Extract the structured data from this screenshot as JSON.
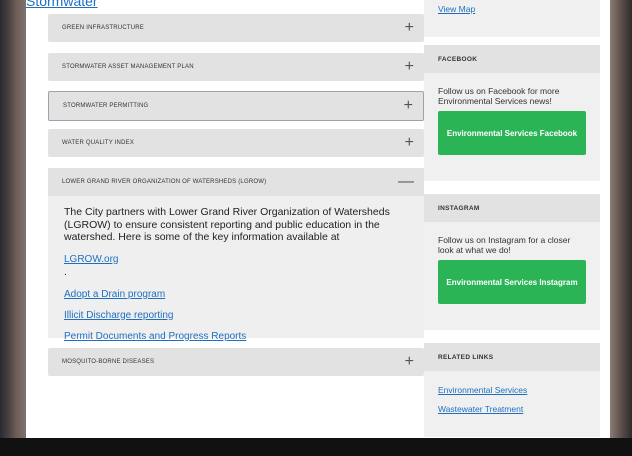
{
  "top_link": "Stormwater",
  "accordion": {
    "items": [
      {
        "title": "GREEN INFRASTRUCTURE",
        "toggle": "+"
      },
      {
        "title": "STORMWATER ASSET MANAGEMENT PLAN",
        "toggle": "+"
      },
      {
        "title": "STORMWATER PERMITTING",
        "toggle": "+"
      },
      {
        "title": "WATER QUALITY INDEX",
        "toggle": "+"
      },
      {
        "title": "LOWER GRAND RIVER ORGANIZATION OF WATERSHEDS (LGROW)",
        "toggle": "—"
      },
      {
        "title": "MOSQUITO-BORNE DISEASES",
        "toggle": "+"
      }
    ],
    "lgrow_body": {
      "text": "The City partners with Lower Grand River Organization of Watersheds (LGROW) to ensure consistent reporting and public education in the watershed. Here is some of the key information available at ",
      "inline_link": "LGROW.org",
      "text_end": ".",
      "links": [
        "Adopt a Drain program",
        "Illicit Discharge reporting",
        "Permit Documents and Progress Reports"
      ]
    }
  },
  "sidebar": {
    "view_map": "View Map",
    "facebook": {
      "heading": "FACEBOOK",
      "text": "Follow us on Facebook for more Environmental Services news!",
      "button": "Environmental Services Facebook"
    },
    "instagram": {
      "heading": "INSTAGRAM",
      "text": "Follow us on Instagram for a closer look at what we do!",
      "button": "Environmental Services Instagram"
    },
    "related": {
      "heading": "RELATED LINKS",
      "links": [
        "Environmental Services",
        "Wastewater Treatment"
      ]
    }
  }
}
